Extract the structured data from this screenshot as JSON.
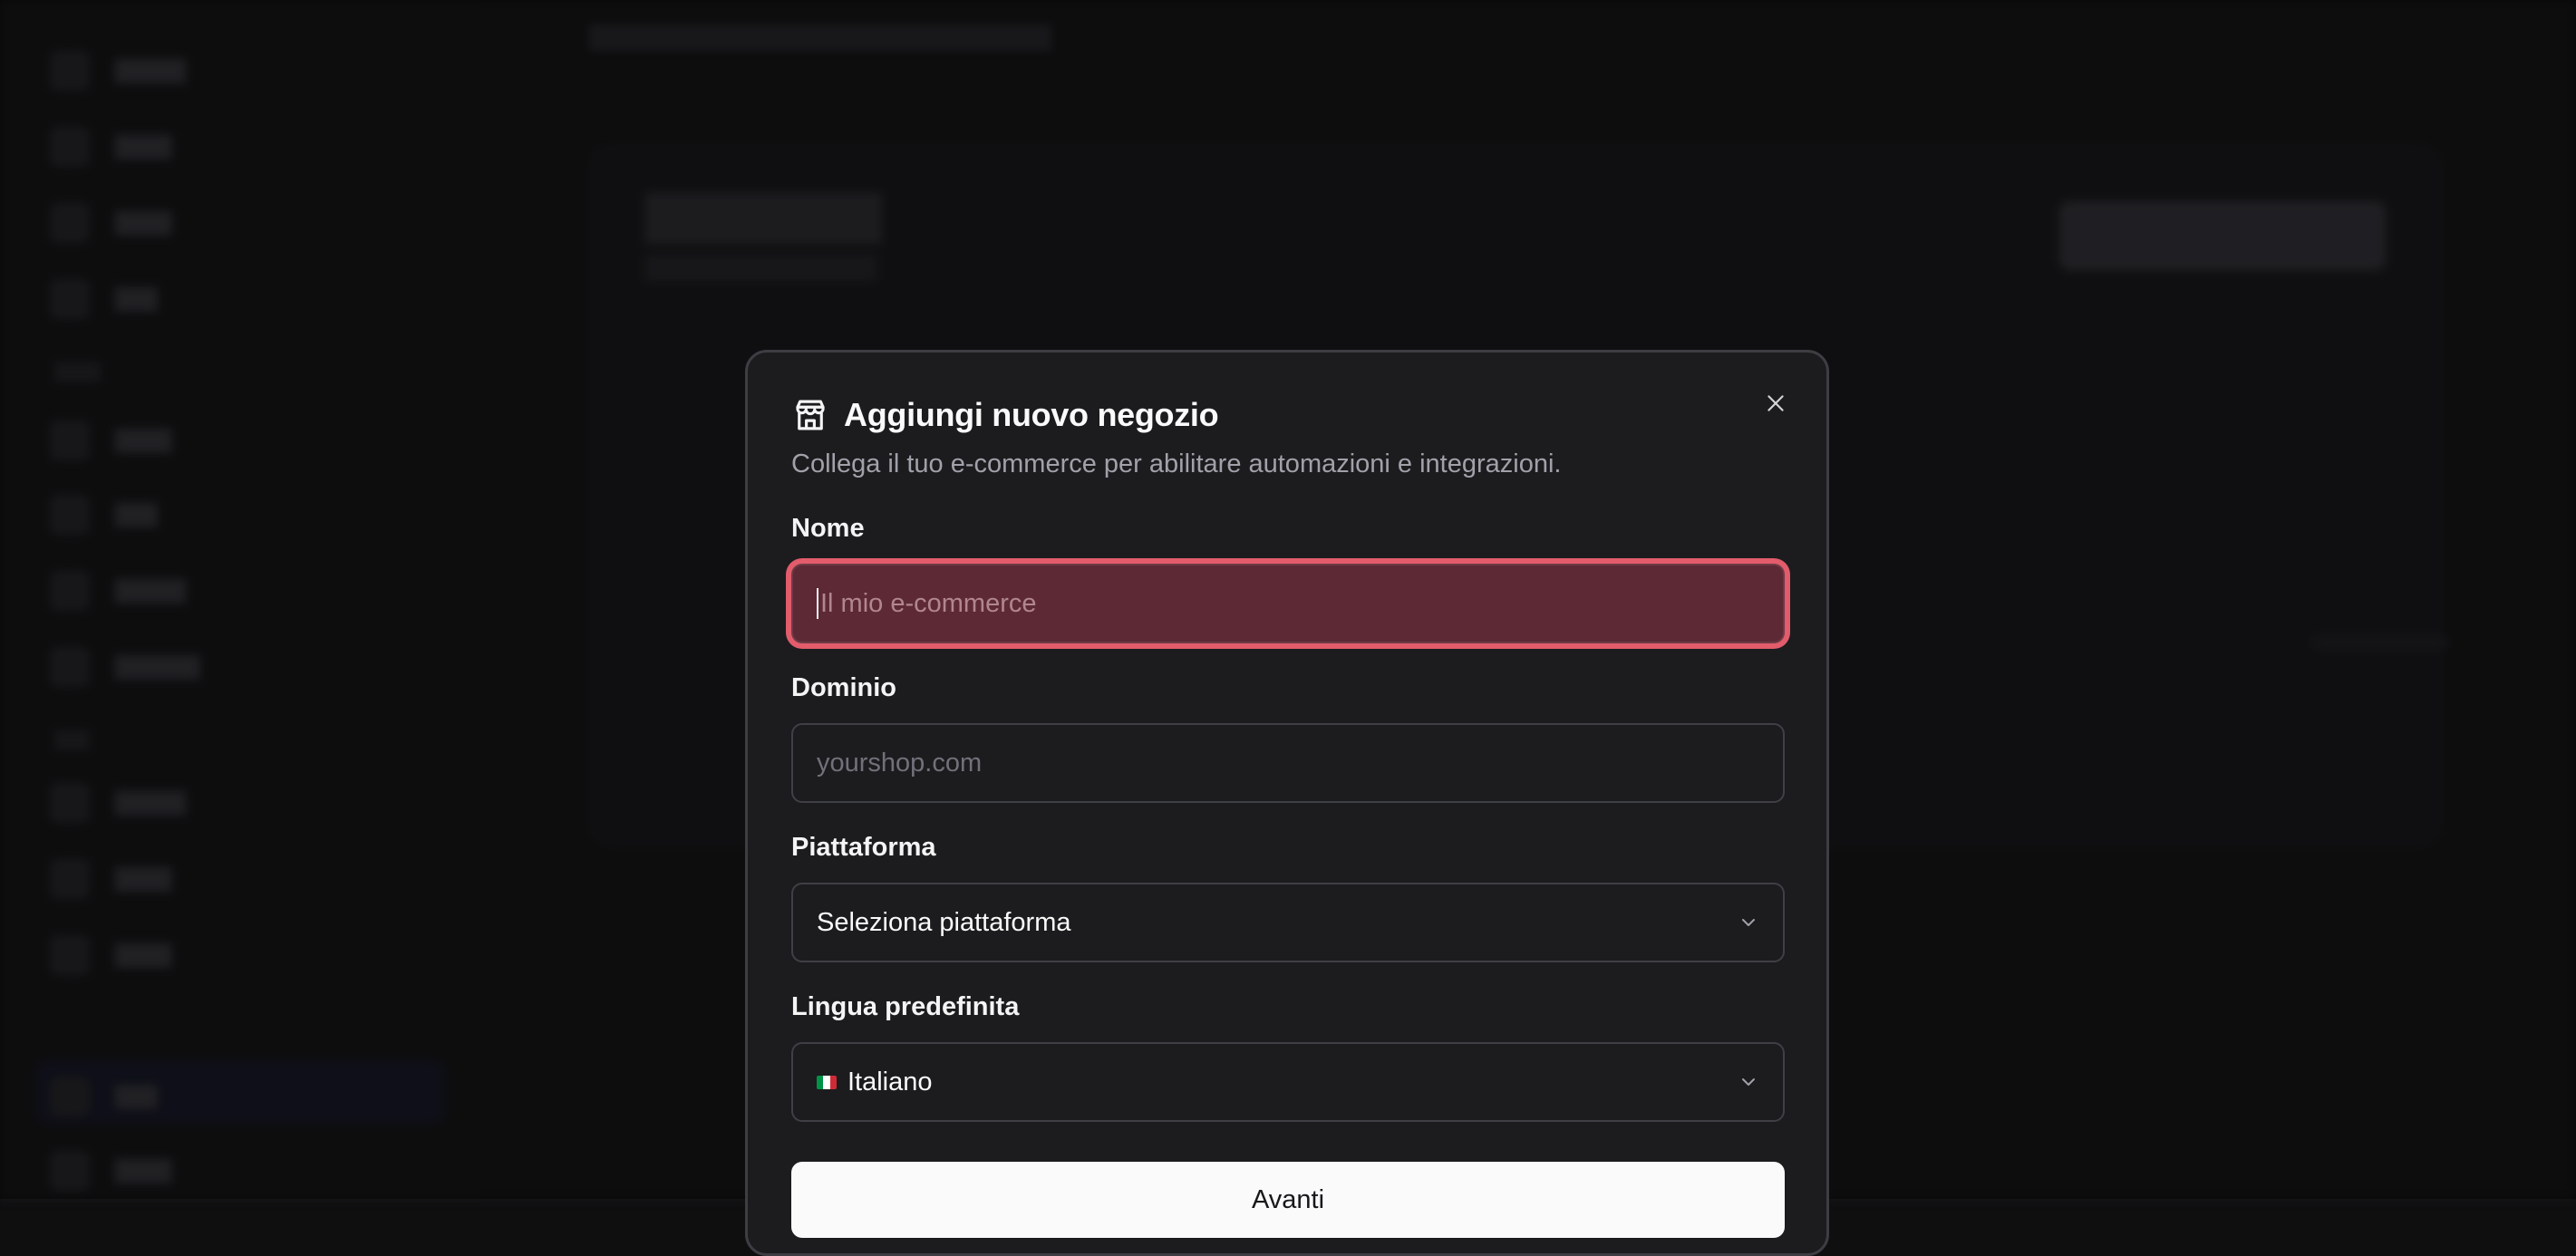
{
  "modal": {
    "title": "Aggiungi nuovo negozio",
    "description": "Collega il tuo e-commerce per abilitare automazioni e integrazioni.",
    "icon": "store-icon",
    "close_icon": "close-icon"
  },
  "form": {
    "name": {
      "label": "Nome",
      "placeholder": "Il mio e-commerce",
      "value": "",
      "state": "error"
    },
    "domain": {
      "label": "Dominio",
      "placeholder": "yourshop.com",
      "value": ""
    },
    "platform": {
      "label": "Piattaforma",
      "selected": "Seleziona piattaforma"
    },
    "language": {
      "label": "Lingua predefinita",
      "selected": "Italiano",
      "flag": "italian-flag-icon"
    },
    "submit_label": "Avanti"
  },
  "colors": {
    "error_ring": "#e25c6c",
    "error_fill": "#5d2934",
    "modal_bg": "#1c1c1f",
    "primary_button": "#fafafa"
  }
}
